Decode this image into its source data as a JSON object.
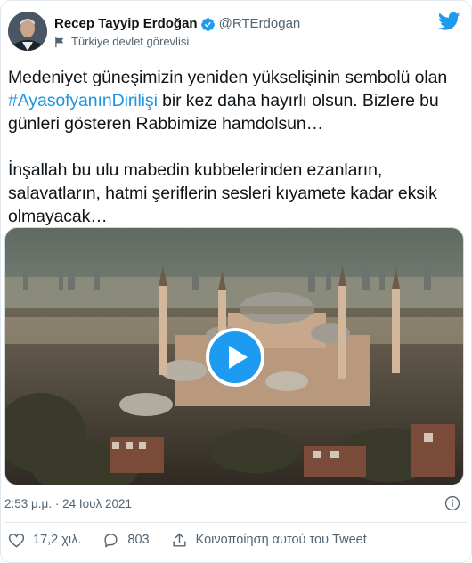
{
  "author": {
    "name": "Recep Tayyip Erdoğan",
    "handle": "@RTErdogan",
    "label": "Türkiye devlet görevlisi"
  },
  "tweet": {
    "line1_pre": "Medeniyet güneşimizin yeniden yükselişinin sembolü olan",
    "hashtag": "#AyasofyanınDirilişi",
    "line1_post": " bir kez daha hayırlı olsun. Bizlere bu günleri gösteren Rabbimize hamdolsun…",
    "paragraph2": "İnşallah bu ulu mabedin kubbelerinden ezanların, salavatların, hatmi şeriflerin sesleri kıyamete kadar eksik olmayacak…"
  },
  "media": {
    "kind": "video",
    "play_icon": "play-icon"
  },
  "meta": {
    "timestamp": "2:53 μ.μ. · 24 Ιουλ 2021",
    "info_icon": "info-icon"
  },
  "actions": {
    "likes": "17,2 χιλ.",
    "replies": "803",
    "share_label": "Κοινοποίηση αυτού του Tweet"
  },
  "colors": {
    "accent": "#1d9bf0",
    "hashtag": "#1b95e0",
    "text": "#0f1419",
    "secondary": "#536471"
  }
}
